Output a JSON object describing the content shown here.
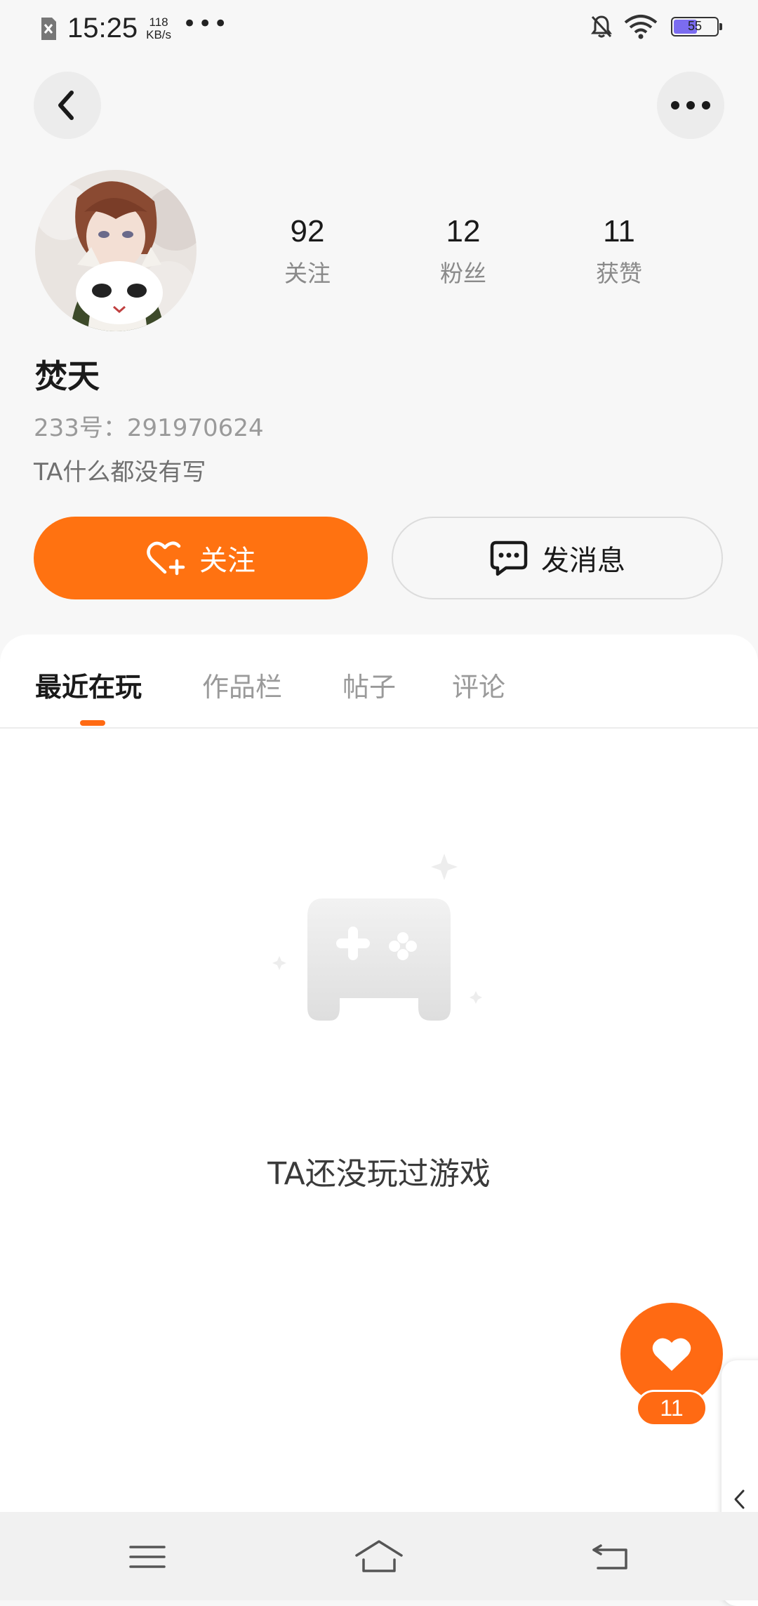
{
  "status_bar": {
    "time": "15:25",
    "speed_value": "118",
    "speed_unit": "KB/s",
    "more_dots": "•••",
    "battery_level": "55",
    "battery_fraction": 0.55,
    "icons": [
      "sim-off-icon",
      "bell-muted-icon",
      "wifi-icon",
      "battery-icon"
    ]
  },
  "header": {
    "back_icon": "back-arrow-icon",
    "more_icon": "more-horizontal-icon"
  },
  "profile": {
    "stats": [
      {
        "value": "92",
        "label": "关注"
      },
      {
        "value": "12",
        "label": "粉丝"
      },
      {
        "value": "11",
        "label": "获赞"
      }
    ],
    "name": "焚天",
    "id_text": "233号：291970624",
    "bio": "TA什么都没有写"
  },
  "actions": {
    "follow_label": "关注",
    "message_label": "发消息"
  },
  "tabs": [
    {
      "label": "最近在玩",
      "active": true
    },
    {
      "label": "作品栏",
      "active": false
    },
    {
      "label": "帖子",
      "active": false
    },
    {
      "label": "评论",
      "active": false
    }
  ],
  "empty_state": {
    "icon": "gamepad-icon",
    "message": "TA还没玩过游戏"
  },
  "like_fab": {
    "icon": "heart-icon",
    "count": "11"
  },
  "nav_bar": {
    "icons": [
      "menu-icon",
      "home-icon",
      "back-icon"
    ]
  },
  "colors": {
    "accent": "#ff7211",
    "background": "#f7f7f7",
    "panel": "#ffffff"
  }
}
